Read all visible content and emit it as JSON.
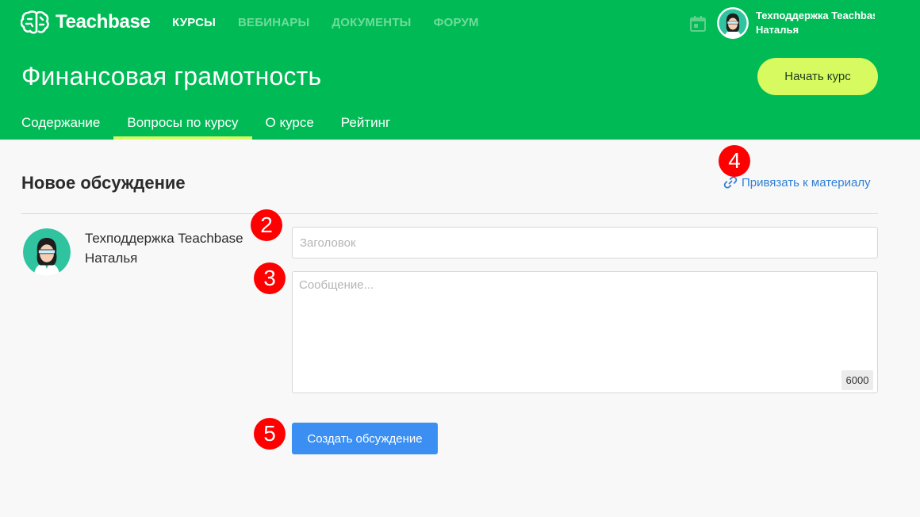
{
  "header": {
    "logo_text": "Teachbase",
    "nav": [
      {
        "label": "КУРСЫ",
        "active": true
      },
      {
        "label": "ВЕБИНАРЫ",
        "active": false
      },
      {
        "label": "ДОКУМЕНТЫ",
        "active": false
      },
      {
        "label": "ФОРУМ",
        "active": false
      }
    ],
    "user_line1": "Техподдержка Teachbase",
    "user_line2": "Наталья",
    "calendar_icon": "calendar-icon"
  },
  "course": {
    "title": "Финансовая грамотность",
    "start_button": "Начать курс",
    "tabs": [
      {
        "label": "Содержание",
        "active": false
      },
      {
        "label": "Вопросы по курсу",
        "active": true
      },
      {
        "label": "О курсе",
        "active": false
      },
      {
        "label": "Рейтинг",
        "active": false
      }
    ]
  },
  "discussion": {
    "heading": "Новое обсуждение",
    "attach_link": "Привязать к материалу",
    "author_line1": "Техподдержка Teachbase",
    "author_line2": "Наталья",
    "title_placeholder": "Заголовок",
    "message_placeholder": "Сообщение...",
    "char_limit": "6000",
    "submit_button": "Создать обсуждение"
  },
  "markers": [
    "2",
    "3",
    "4",
    "5"
  ],
  "colors": {
    "brand_green": "#00bb55",
    "accent_lime": "#d6fa5f",
    "primary_blue": "#3b8ff3",
    "link_blue": "#2f7fd7",
    "marker_red": "#ff0000"
  }
}
